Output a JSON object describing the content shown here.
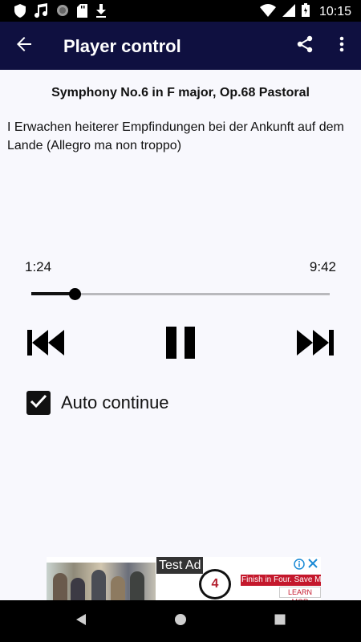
{
  "status_bar": {
    "time": "10:15",
    "icons_left": [
      "shield-icon",
      "music-note-icon",
      "circle-icon",
      "sd-card-icon",
      "download-icon"
    ],
    "icons_right": [
      "wifi-icon",
      "signal-icon",
      "battery-icon"
    ]
  },
  "app_bar": {
    "title": "Player control",
    "back_icon": "arrow-back-icon",
    "share_icon": "share-icon",
    "more_icon": "more-vert-icon",
    "background": "#0f1040"
  },
  "track": {
    "work": "Symphony No.6 in F major, Op.68 Pastoral",
    "movement": "I Erwachen heiterer Empfindungen bei der Ankunft auf dem Lande (Allegro ma non troppo)"
  },
  "playback": {
    "current_time": "1:24",
    "total_time": "9:42",
    "progress": 0.144,
    "state": "playing",
    "prev_icon": "skip-previous-icon",
    "pause_icon": "pause-icon",
    "next_icon": "skip-next-icon"
  },
  "auto_continue": {
    "label": "Auto continue",
    "checked": true
  },
  "ad": {
    "label": "Test Ad",
    "logo_text": "4",
    "headline": "Finish in Four. Save Mor",
    "cta": "LEARN MOR",
    "info_icon": "info-icon",
    "close_icon": "close-icon",
    "accent": "#c4182c"
  },
  "nav_bar": {
    "back_icon": "nav-back-icon",
    "home_icon": "nav-home-icon",
    "recents_icon": "nav-recents-icon"
  }
}
